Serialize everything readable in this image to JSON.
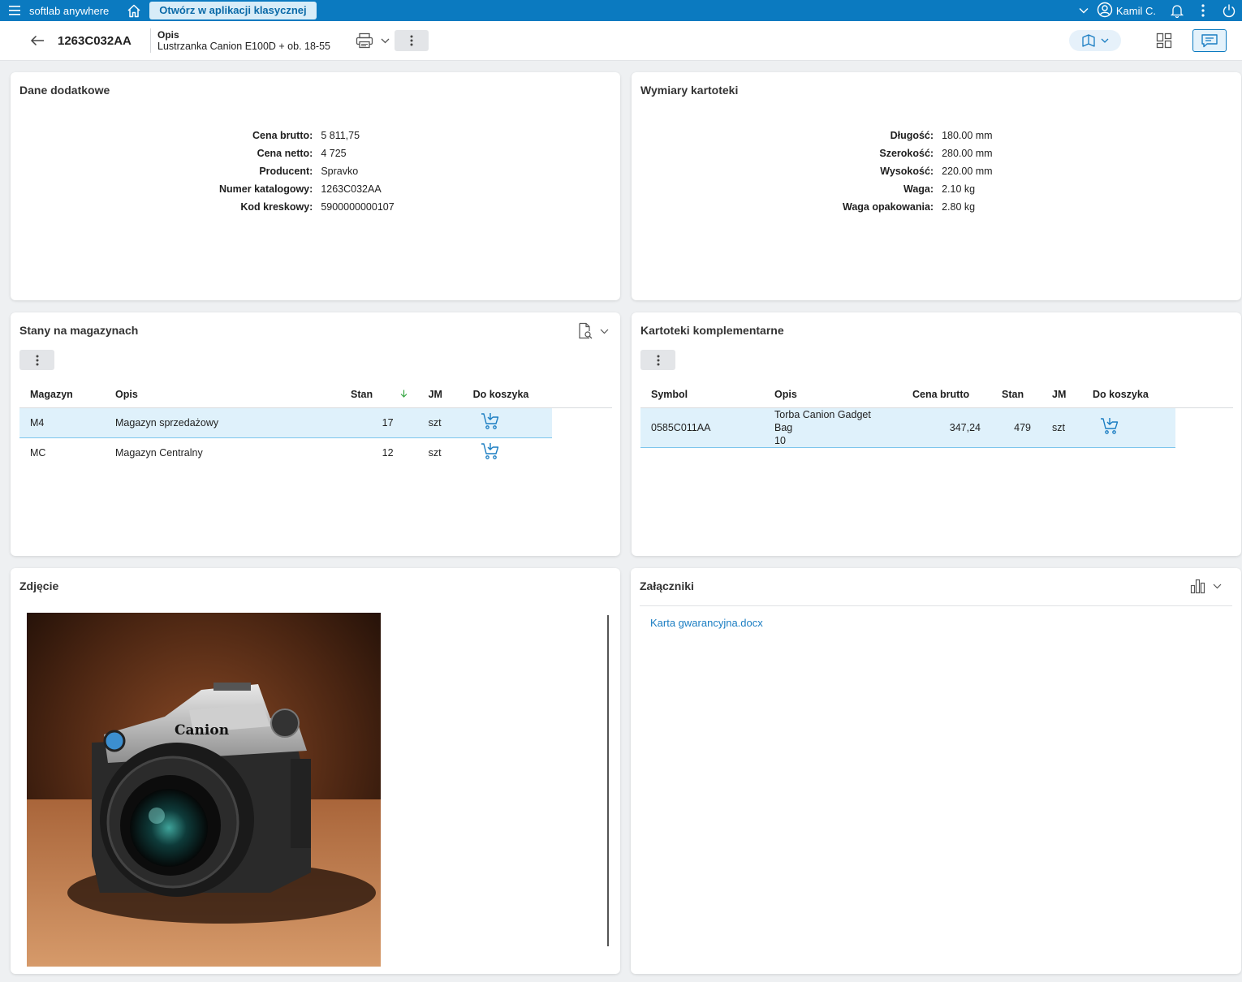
{
  "topbar": {
    "app_name": "softlab anywhere",
    "classic_button": "Otwórz w aplikacji klasycznej",
    "user_name": "Kamil C."
  },
  "header": {
    "code": "1263C032AA",
    "desc_label": "Opis",
    "desc_value": "Lustrzanka Canion E100D + ob. 18-55"
  },
  "dane_dodatkowe": {
    "title": "Dane dodatkowe",
    "rows": [
      {
        "label": "Cena brutto:",
        "value": "5 811,75"
      },
      {
        "label": "Cena netto:",
        "value": "4 725"
      },
      {
        "label": "Producent:",
        "value": "Spravko"
      },
      {
        "label": "Numer katalogowy:",
        "value": "1263C032AA"
      },
      {
        "label": "Kod kreskowy:",
        "value": "5900000000107"
      }
    ]
  },
  "wymiary": {
    "title": "Wymiary kartoteki",
    "rows": [
      {
        "label": "Długość:",
        "value": "180.00 mm"
      },
      {
        "label": "Szerokość:",
        "value": "280.00 mm"
      },
      {
        "label": "Wysokość:",
        "value": "220.00 mm"
      },
      {
        "label": "Waga:",
        "value": "2.10 kg"
      },
      {
        "label": "Waga opakowania:",
        "value": "2.80 kg"
      }
    ]
  },
  "stany": {
    "title": "Stany na magazynach",
    "columns": [
      "Magazyn",
      "Opis",
      "Stan",
      "JM",
      "Do koszyka"
    ],
    "rows": [
      {
        "magazyn": "M4",
        "opis": "Magazyn sprzedażowy",
        "stan": "17",
        "jm": "szt"
      },
      {
        "magazyn": "MC",
        "opis": "Magazyn Centralny",
        "stan": "12",
        "jm": "szt"
      }
    ]
  },
  "komplementarne": {
    "title": "Kartoteki komplementarne",
    "columns": [
      "Symbol",
      "Opis",
      "Cena brutto",
      "Stan",
      "JM",
      "Do koszyka"
    ],
    "rows": [
      {
        "symbol": "0585C011AA",
        "opis_line1": "Torba Canion Gadget Bag",
        "opis_line2": "10",
        "cena": "347,24",
        "stan": "479",
        "jm": "szt"
      }
    ]
  },
  "zdjecie": {
    "title": "Zdjęcie",
    "brand_text": "Canion"
  },
  "zalaczniki": {
    "title": "Załączniki",
    "files": [
      "Karta gwarancyjna.docx"
    ]
  },
  "colors": {
    "brand_blue": "#0b7ac0",
    "selected_row": "#dff1fb",
    "link": "#1a7dc2"
  }
}
